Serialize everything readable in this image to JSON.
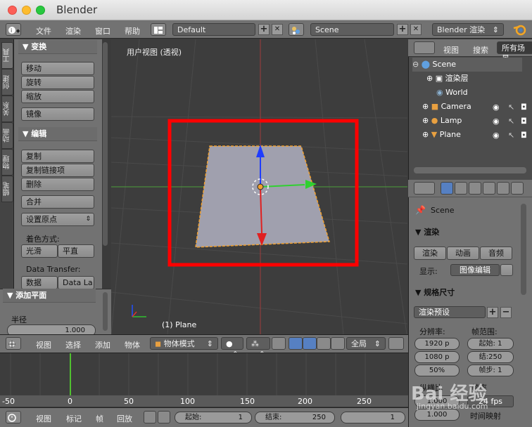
{
  "window": {
    "title": "Blender"
  },
  "topbar": {
    "menus": [
      "文件",
      "渲染",
      "窗口",
      "帮助"
    ],
    "layout": "Default",
    "scene": "Scene",
    "engine": "Blender 渲染",
    "plus": "+",
    "close": "✕"
  },
  "sidetabs": [
    "工具",
    "创建",
    "关系",
    "动画",
    "物理",
    "蜡笔"
  ],
  "tools": {
    "transform_header": "▼ 变换",
    "move": "移动",
    "rotate": "旋转",
    "scale": "缩放",
    "mirror": "镜像",
    "edit_header": "▼ 编辑",
    "duplicate": "复制",
    "duplicate_linked": "复制链接项",
    "delete": "删除",
    "join": "合并",
    "set_origin": "设置原点",
    "shading_label": "着色方式:",
    "smooth": "光滑",
    "flat": "平直",
    "data_transfer_label": "Data Transfer:",
    "data": "数据",
    "data_layout": "Data La"
  },
  "operator": {
    "header": "▼ 添加平面",
    "radius_label": "半径",
    "radius_value": "1.000"
  },
  "viewport": {
    "title": "用户视图 (透视)",
    "object_label": "(1) Plane"
  },
  "viewheader": {
    "menus": [
      "视图",
      "选择",
      "添加",
      "物体"
    ],
    "mode": "物体模式",
    "orientation": "全局"
  },
  "timeline": {
    "ticks": [
      "-50",
      "0",
      "50",
      "100",
      "150",
      "200",
      "250"
    ],
    "current_frame": 1
  },
  "timeheader": {
    "menus": [
      "视图",
      "标记",
      "帧",
      "回放"
    ],
    "start_label": "起始:",
    "start_value": "1",
    "end_label": "结束:",
    "end_value": "250",
    "current": "1"
  },
  "outliner": {
    "menus": [
      "视图",
      "搜索"
    ],
    "filter": "所有场景",
    "rows": [
      {
        "label": "Scene"
      },
      {
        "label": "渲染层"
      },
      {
        "label": "World"
      },
      {
        "label": "Camera"
      },
      {
        "label": "Lamp"
      },
      {
        "label": "Plane"
      }
    ]
  },
  "properties": {
    "context": "Scene",
    "render_header": "▼ 渲染",
    "render_btn": "渲染",
    "anim_btn": "动画",
    "audio_btn": "音频",
    "display_label": "显示:",
    "display_value": "图像编辑",
    "dimensions_header": "▼ 规格尺寸",
    "preset": "渲染预设",
    "resolution_label": "分辨率:",
    "frame_range_label": "帧范围:",
    "res_x": "1920 p",
    "res_y": "1080 p",
    "res_pct": "50%",
    "frame_start": "起始: 1",
    "frame_end": "结:250",
    "frame_step": "帧步: 1",
    "aspect_label": "纵横比",
    "frame_rate_label": "帧率",
    "aspect_x": "1.000",
    "aspect_y": "1.000",
    "fps": "24 fps",
    "time_remap": "时间映射"
  },
  "watermark": {
    "brand": "Bai 经验",
    "url": "jingyan.baidu.com"
  },
  "colors": {
    "selection_box": "#ff0000",
    "plane": "#a0a0ae",
    "timeline_cursor": "#50c030"
  }
}
